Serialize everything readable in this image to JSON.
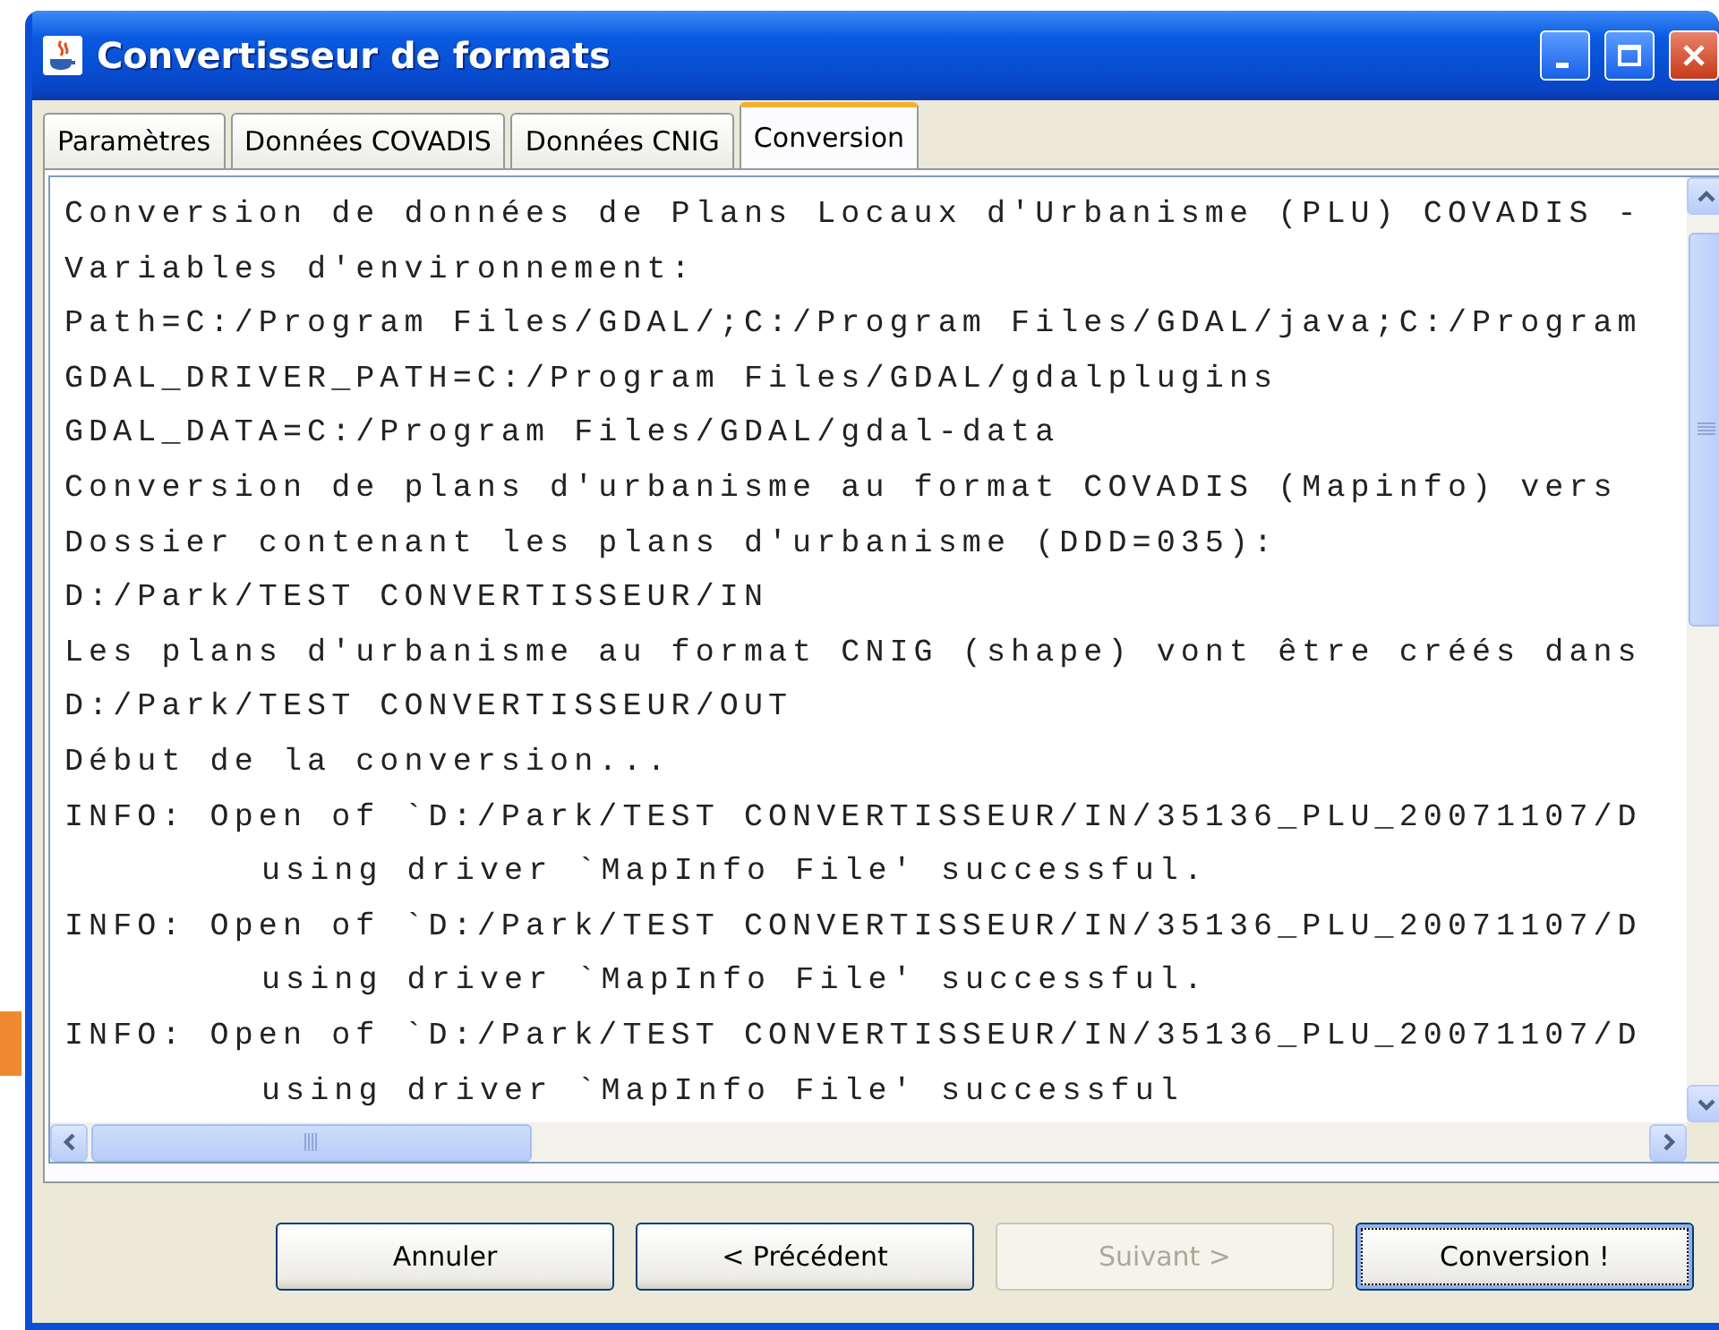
{
  "window": {
    "title": "Convertisseur de formats"
  },
  "tabs": [
    {
      "label": "Paramètres",
      "selected": false
    },
    {
      "label": "Données COVADIS",
      "selected": false
    },
    {
      "label": "Données CNIG",
      "selected": false
    },
    {
      "label": "Conversion",
      "selected": true
    }
  ],
  "log": {
    "lines": [
      {
        "kind": "plain",
        "text": "Conversion de données de Plans Locaux d'Urbanisme (PLU) COVADIS -"
      },
      {
        "kind": "plain",
        "text": "Variables d'environnement:"
      },
      {
        "kind": "plain",
        "text": "Path=C:/Program Files/GDAL/;C:/Program Files/GDAL/java;C:/Program"
      },
      {
        "kind": "plain",
        "text": "GDAL_DRIVER_PATH=C:/Program Files/GDAL/gdalplugins"
      },
      {
        "kind": "plain",
        "text": "GDAL_DATA=C:/Program Files/GDAL/gdal-data"
      },
      {
        "kind": "plain",
        "text": "Conversion de plans d'urbanisme au format COVADIS (Mapinfo) vers"
      },
      {
        "kind": "plain",
        "text": "Dossier contenant les plans d'urbanisme (DDD=035):"
      },
      {
        "kind": "plain",
        "text": "D:/Park/TEST CONVERTISSEUR/IN"
      },
      {
        "kind": "plain",
        "text": "Les plans d'urbanisme au format CNIG (shape) vont être créés dans"
      },
      {
        "kind": "plain",
        "text": "D:/Park/TEST CONVERTISSEUR/OUT"
      },
      {
        "kind": "plain",
        "text": "Début de la conversion..."
      },
      {
        "kind": "plain",
        "text": "INFO: Open of `D:/Park/TEST CONVERTISSEUR/IN/35136_PLU_20071107/D"
      },
      {
        "kind": "continuation",
        "text": "using driver `MapInfo File' successful."
      },
      {
        "kind": "plain",
        "text": "INFO: Open of `D:/Park/TEST CONVERTISSEUR/IN/35136_PLU_20071107/D"
      },
      {
        "kind": "continuation",
        "text": "using driver `MapInfo File' successful."
      },
      {
        "kind": "plain",
        "text": "INFO: Open of `D:/Park/TEST CONVERTISSEUR/IN/35136_PLU_20071107/D"
      },
      {
        "kind": "continuation",
        "text": "using driver `MapInfo File' successful"
      }
    ]
  },
  "buttons": [
    {
      "label": "Annuler",
      "disabled": false,
      "default": false
    },
    {
      "label": "< Précédent",
      "disabled": false,
      "default": false
    },
    {
      "label": "Suivant >",
      "disabled": true,
      "default": false
    },
    {
      "label": "Conversion !",
      "disabled": false,
      "default": true
    }
  ]
}
